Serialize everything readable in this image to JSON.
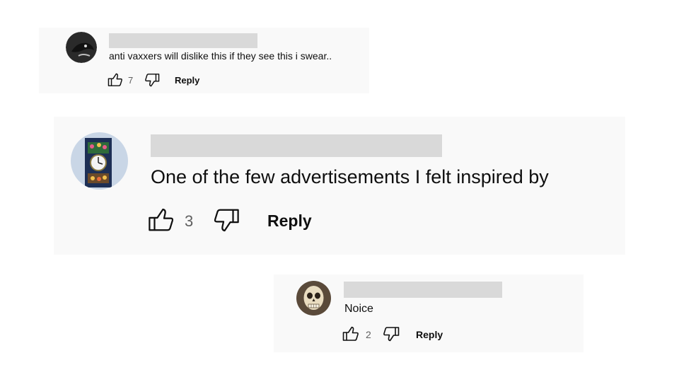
{
  "comments": [
    {
      "text": "anti vaxxers will dislike this if they see this i swear..",
      "likes": "7",
      "reply_label": "Reply",
      "avatar_icon": "dark-bird-avatar"
    },
    {
      "text": "One of the few advertisements I felt inspired by",
      "likes": "3",
      "reply_label": "Reply",
      "avatar_icon": "clock-tower-avatar"
    },
    {
      "text": "Noice",
      "likes": "2",
      "reply_label": "Reply",
      "avatar_icon": "skull-avatar"
    }
  ],
  "icons": {
    "like": "thumbs-up-icon",
    "dislike": "thumbs-down-icon"
  },
  "colors": {
    "card_background": "#f9f9f9",
    "redacted_name": "#d9d9d9",
    "count_text": "#606060"
  }
}
